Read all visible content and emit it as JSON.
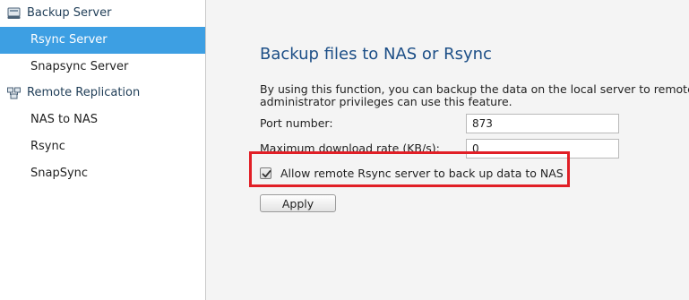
{
  "sidebar": {
    "groups": [
      {
        "label": "Backup Server",
        "icon": "server-icon",
        "items": [
          {
            "label": "Rsync Server",
            "active": true
          },
          {
            "label": "Snapsync Server",
            "active": false
          }
        ]
      },
      {
        "label": "Remote Replication",
        "icon": "network-icon",
        "items": [
          {
            "label": "NAS to NAS",
            "active": false
          },
          {
            "label": "Rsync",
            "active": false
          },
          {
            "label": "SnapSync",
            "active": false
          }
        ]
      }
    ]
  },
  "main": {
    "title": "Backup files to NAS or Rsync",
    "description_line1": "By using this function, you can backup the data on the local server to remote",
    "description_line2": "administrator privileges can use this feature.",
    "port_label": "Port number:",
    "port_value": "873",
    "rate_label": "Maximum download rate (KB/s):",
    "rate_value": "0",
    "allow_label": "Allow remote Rsync server to back up data to NAS",
    "allow_checked": true,
    "apply_label": "Apply"
  },
  "colors": {
    "active_item": "#3d9fe3",
    "title": "#1d4f87",
    "highlight": "#e11f26"
  }
}
